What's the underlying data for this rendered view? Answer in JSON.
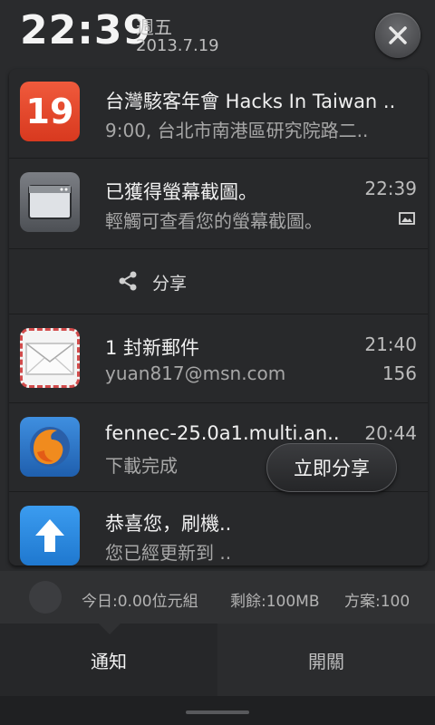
{
  "header": {
    "time": "22:39",
    "weekday": "週五",
    "date": "2013.7.19"
  },
  "notifications": [
    {
      "icon": "calendar-icon",
      "icon_text": "19",
      "title": "台灣駭客年會 Hacks In Taiwan ..",
      "subtitle": "9:00, 台北市南港區研究院路二..",
      "time": ""
    },
    {
      "icon": "screenshot-icon",
      "title": "已獲得螢幕截圖。",
      "subtitle": "輕觸可查看您的螢幕截圖。",
      "time": "22:39",
      "badge_icon": "image-icon"
    },
    {
      "icon": "mail-icon",
      "title": "1 封新郵件",
      "subtitle": "yuan817@msn.com",
      "time": "21:40",
      "count": "156"
    },
    {
      "icon": "firefox-icon",
      "title": "fennec-25.0a1.multi.an..",
      "subtitle": "下載完成",
      "time": "20:44"
    },
    {
      "icon": "update-arrow-icon",
      "title": "恭喜您，刷機..",
      "subtitle": "您已經更新到 ..",
      "action_label": "立即分享"
    }
  ],
  "share_action": {
    "icon": "share-icon",
    "label": "分享"
  },
  "data_usage": {
    "today": "今日:0.00位元組",
    "remaining": "剩餘:100MB",
    "plan": "方案:100"
  },
  "tabs": {
    "notifications": "通知",
    "toggles": "開關"
  },
  "colors": {
    "calendar_red": "#e8492d",
    "update_blue": "#2f8fe0",
    "panel_bg": "#28292b"
  }
}
